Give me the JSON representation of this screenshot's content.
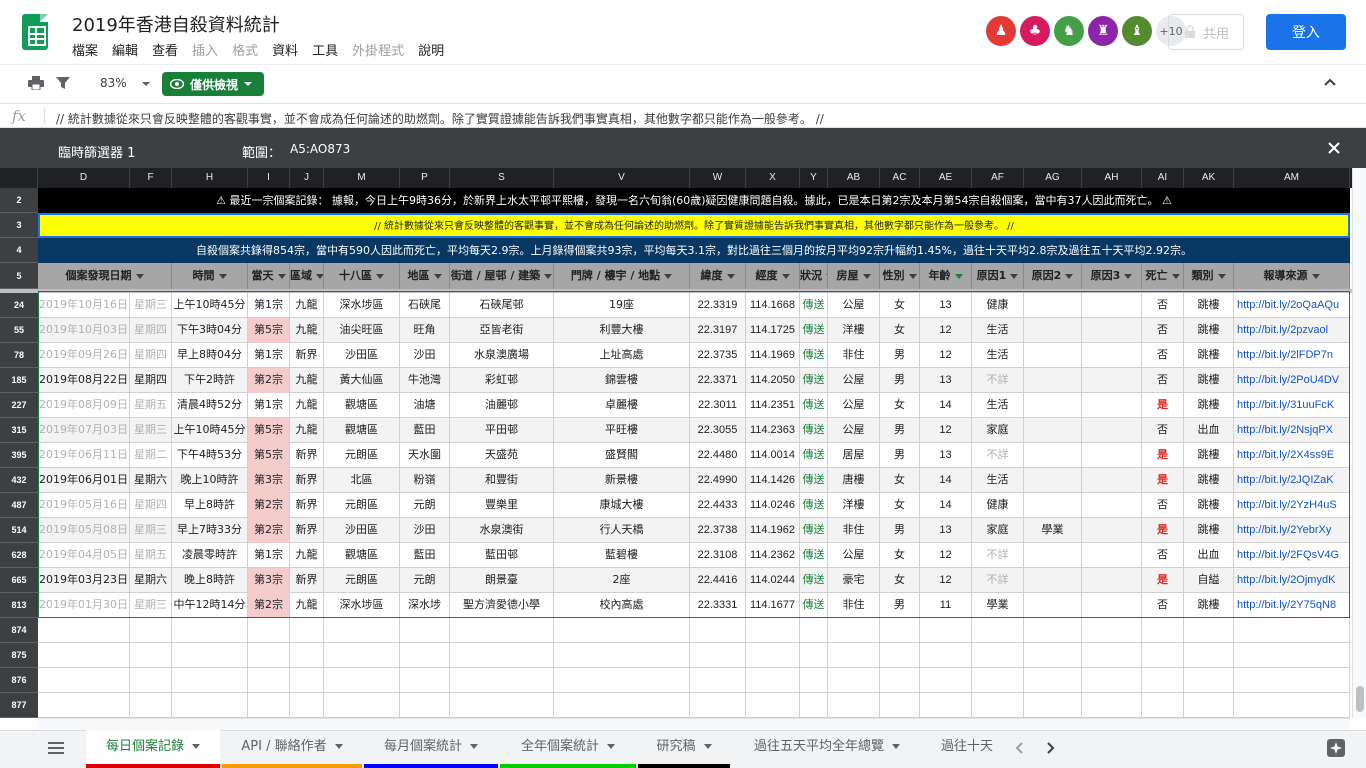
{
  "app": {
    "title": "2019年香港自殺資料統計",
    "menu": [
      "檔案",
      "編輯",
      "查看",
      "插入",
      "格式",
      "資料",
      "工具",
      "外掛程式",
      "說明"
    ],
    "menu_disabled": [
      false,
      false,
      false,
      true,
      true,
      false,
      false,
      true,
      false
    ],
    "avatar_more": "+10",
    "share_label": "共用",
    "login_label": "登入"
  },
  "toolbar": {
    "zoom": "83%",
    "view_mode": "僅供檢視"
  },
  "formula_bar": {
    "fx": "fx",
    "content": "// 統計數據從來只會反映整體的客觀事實，並不會成為任何論述的助燃劑。除了實質證據能告訴我們事實真相，其他數字都只能作為一般參考。 //"
  },
  "filter_view": {
    "name": "臨時篩選器 1",
    "range_label": "範圍：",
    "range_value": "A5:AO873"
  },
  "column_letters": [
    "D",
    "F",
    "H",
    "I",
    "J",
    "M",
    "P",
    "S",
    "V",
    "W",
    "X",
    "Y",
    "AB",
    "AC",
    "AE",
    "AF",
    "AG",
    "AH",
    "AI",
    "AK",
    "AM"
  ],
  "row_numbers": {
    "banner": [
      "2",
      "3",
      "4"
    ],
    "header": "5",
    "data": [
      "24",
      "55",
      "78",
      "185",
      "227",
      "315",
      "395",
      "432",
      "487",
      "514",
      "628",
      "665",
      "813"
    ],
    "empty": [
      "874",
      "875",
      "876",
      "877"
    ]
  },
  "banners": {
    "alert_prefix": "最近一宗個案記錄：",
    "alert_text": "據報，今日上午9時36分，於新界上水太平邨平熙樓，發現一名六旬翁(60歲)疑因健康問題自殺。據此，已是本日第2宗及本月第54宗自殺個案，當中有37人因此而死亡。",
    "note": "// 統計數據從來只會反映整體的客觀事實，並不會成為任何論述的助燃劑。除了實質證據能告訴我們事實真相，其他數字都只能作為一般參考。 //",
    "stats": "自殺個案共錄得854宗，當中有590人因此而死亡，平均每天2.9宗。上月錄得個案共93宗，平均每天3.1宗，對比過往三個月的按月平均92宗升幅約1.45%，過往十天平均2.8宗及過往五十天平均2.92宗。"
  },
  "headers": [
    "個案發現日期",
    "時間",
    "當天",
    "區域",
    "十八區",
    "地區",
    "街道 / 屋邨 / 建築",
    "門牌 / 樓宇 / 地點",
    "緯度",
    "經度",
    "狀況",
    "房屋",
    "性別",
    "年齡",
    "原因1",
    "原因2",
    "原因3",
    "死亡",
    "類別",
    "報導來源"
  ],
  "rows": [
    {
      "date": "2019年10月16日",
      "weekday": "星期三",
      "time": "上午10時45分",
      "day": "第1宗",
      "region": "九龍",
      "district": "深水埗區",
      "area": "石硤尾",
      "street": "石硤尾邨",
      "place": "19座",
      "lat": "22.3319",
      "lng": "114.1668",
      "status": "傳送",
      "housing": "公屋",
      "sex": "女",
      "age": "13",
      "r1": "健康",
      "r2": "",
      "r3": "",
      "death": "否",
      "type": "跳樓",
      "src": "http://bit.ly/2oQaAQu",
      "gray": true
    },
    {
      "date": "2019年10月03日",
      "weekday": "星期四",
      "time": "下午3時04分",
      "day": "第5宗",
      "region": "九龍",
      "district": "油尖旺區",
      "area": "旺角",
      "street": "亞皆老街",
      "place": "利豐大樓",
      "lat": "22.3197",
      "lng": "114.1725",
      "status": "傳送",
      "housing": "洋樓",
      "sex": "女",
      "age": "12",
      "r1": "生活",
      "r2": "",
      "r3": "",
      "death": "否",
      "type": "跳樓",
      "src": "http://bit.ly/2pzvaol",
      "gray": true
    },
    {
      "date": "2019年09月26日",
      "weekday": "星期四",
      "time": "早上8時04分",
      "day": "第1宗",
      "region": "新界",
      "district": "沙田區",
      "area": "沙田",
      "street": "水泉澳廣場",
      "place": "上址高處",
      "lat": "22.3735",
      "lng": "114.1969",
      "status": "傳送",
      "housing": "非住",
      "sex": "男",
      "age": "12",
      "r1": "生活",
      "r2": "",
      "r3": "",
      "death": "否",
      "type": "跳樓",
      "src": "http://bit.ly/2lFDP7n",
      "gray": true
    },
    {
      "date": "2019年08月22日",
      "weekday": "星期四",
      "time": "下午2時許",
      "day": "第2宗",
      "region": "九龍",
      "district": "黃大仙區",
      "area": "牛池灣",
      "street": "彩虹邨",
      "place": "錦雲樓",
      "lat": "22.3371",
      "lng": "114.2050",
      "status": "傳送",
      "housing": "公屋",
      "sex": "男",
      "age": "13",
      "r1": "不詳",
      "r2": "",
      "r3": "",
      "death": "否",
      "type": "跳樓",
      "src": "http://bit.ly/2PoU4DV",
      "gray": false
    },
    {
      "date": "2019年08月09日",
      "weekday": "星期五",
      "time": "清晨4時52分",
      "day": "第1宗",
      "region": "九龍",
      "district": "觀塘區",
      "area": "油塘",
      "street": "油麗邨",
      "place": "卓麗樓",
      "lat": "22.3011",
      "lng": "114.2351",
      "status": "傳送",
      "housing": "公屋",
      "sex": "女",
      "age": "14",
      "r1": "生活",
      "r2": "",
      "r3": "",
      "death": "是",
      "type": "跳樓",
      "src": "http://bit.ly/31uuFcK",
      "gray": true
    },
    {
      "date": "2019年07月03日",
      "weekday": "星期三",
      "time": "上午10時45分",
      "day": "第5宗",
      "region": "九龍",
      "district": "觀塘區",
      "area": "藍田",
      "street": "平田邨",
      "place": "平旺樓",
      "lat": "22.3055",
      "lng": "114.2363",
      "status": "傳送",
      "housing": "公屋",
      "sex": "男",
      "age": "12",
      "r1": "家庭",
      "r2": "",
      "r3": "",
      "death": "否",
      "type": "出血",
      "src": "http://bit.ly/2NsjqPX",
      "gray": true
    },
    {
      "date": "2019年06月11日",
      "weekday": "星期二",
      "time": "下午4時53分",
      "day": "第5宗",
      "region": "新界",
      "district": "元朗區",
      "area": "天水圍",
      "street": "天盛苑",
      "place": "盛賢閣",
      "lat": "22.4480",
      "lng": "114.0014",
      "status": "傳送",
      "housing": "居屋",
      "sex": "男",
      "age": "13",
      "r1": "不詳",
      "r2": "",
      "r3": "",
      "death": "是",
      "type": "跳樓",
      "src": "http://bit.ly/2X4ss9E",
      "gray": true
    },
    {
      "date": "2019年06月01日",
      "weekday": "星期六",
      "time": "晚上10時許",
      "day": "第3宗",
      "region": "新界",
      "district": "北區",
      "area": "粉嶺",
      "street": "和豐街",
      "place": "新景樓",
      "lat": "22.4990",
      "lng": "114.1426",
      "status": "傳送",
      "housing": "唐樓",
      "sex": "女",
      "age": "14",
      "r1": "生活",
      "r2": "",
      "r3": "",
      "death": "是",
      "type": "跳樓",
      "src": "http://bit.ly/2JQIZaK",
      "gray": false
    },
    {
      "date": "2019年05月16日",
      "weekday": "星期四",
      "time": "早上8時許",
      "day": "第2宗",
      "region": "新界",
      "district": "元朗區",
      "area": "元朗",
      "street": "豐樂里",
      "place": "康城大樓",
      "lat": "22.4433",
      "lng": "114.0246",
      "status": "傳送",
      "housing": "洋樓",
      "sex": "女",
      "age": "14",
      "r1": "健康",
      "r2": "",
      "r3": "",
      "death": "否",
      "type": "跳樓",
      "src": "http://bit.ly/2YzH4uS",
      "gray": true
    },
    {
      "date": "2019年05月08日",
      "weekday": "星期三",
      "time": "早上7時33分",
      "day": "第2宗",
      "region": "新界",
      "district": "沙田區",
      "area": "沙田",
      "street": "水泉澳街",
      "place": "行人天橋",
      "lat": "22.3738",
      "lng": "114.1962",
      "status": "傳送",
      "housing": "非住",
      "sex": "男",
      "age": "13",
      "r1": "家庭",
      "r2": "學業",
      "r3": "",
      "death": "是",
      "type": "跳樓",
      "src": "http://bit.ly/2YebrXy",
      "gray": true
    },
    {
      "date": "2019年04月05日",
      "weekday": "星期五",
      "time": "凌晨零時許",
      "day": "第1宗",
      "region": "九龍",
      "district": "觀塘區",
      "area": "藍田",
      "street": "藍田邨",
      "place": "藍碧樓",
      "lat": "22.3108",
      "lng": "114.2362",
      "status": "傳送",
      "housing": "公屋",
      "sex": "女",
      "age": "12",
      "r1": "不詳",
      "r2": "",
      "r3": "",
      "death": "否",
      "type": "出血",
      "src": "http://bit.ly/2FQsV4G",
      "gray": true
    },
    {
      "date": "2019年03月23日",
      "weekday": "星期六",
      "time": "晚上8時許",
      "day": "第3宗",
      "region": "新界",
      "district": "元朗區",
      "area": "元朗",
      "street": "朗景臺",
      "place": "2座",
      "lat": "22.4416",
      "lng": "114.0244",
      "status": "傳送",
      "housing": "豪宅",
      "sex": "女",
      "age": "12",
      "r1": "不詳",
      "r2": "",
      "r3": "",
      "death": "是",
      "type": "自縊",
      "src": "http://bit.ly/2OjmydK",
      "gray": false
    },
    {
      "date": "2019年01月30日",
      "weekday": "星期三",
      "time": "中午12時14分",
      "day": "第2宗",
      "region": "九龍",
      "district": "深水埗區",
      "area": "深水埗",
      "street": "聖方濟愛德小學",
      "place": "校內高處",
      "lat": "22.3331",
      "lng": "114.1677",
      "status": "傳送",
      "housing": "非住",
      "sex": "男",
      "age": "11",
      "r1": "學業",
      "r2": "",
      "r3": "",
      "death": "否",
      "type": "跳樓",
      "src": "http://bit.ly/2Y75qN8",
      "gray": true
    }
  ],
  "sheet_tabs": [
    {
      "label": "每日個案記錄",
      "color": "#e00000",
      "active": true
    },
    {
      "label": "API / 聯絡作者",
      "color": "#ff9900",
      "active": false
    },
    {
      "label": "每月個案統計",
      "color": "#0000ff",
      "active": false
    },
    {
      "label": "全年個案統計",
      "color": "#00cc00",
      "active": false
    },
    {
      "label": "研究稿",
      "color": "#000000",
      "active": false
    },
    {
      "label": "過往五天平均全年總覽",
      "color": "",
      "active": false
    },
    {
      "label": "過往十天",
      "color": "",
      "active": false
    }
  ],
  "colors": {
    "accent_green": "#188038",
    "login_blue": "#1a73e8",
    "banner_navy": "#073763",
    "banner_yellow": "#ffff00",
    "death_red": "#d93025",
    "count_highlight": "#f4cccc"
  }
}
